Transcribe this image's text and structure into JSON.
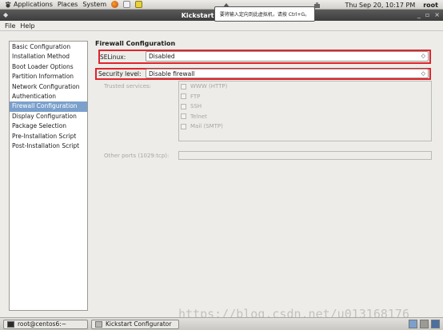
{
  "top_panel": {
    "menus": [
      "Applications",
      "Places",
      "System"
    ],
    "datetime": "Thu Sep 20, 10:17 PM",
    "user": "root"
  },
  "tooltip": {
    "text": "要将输入定向到此虚拟机，请按 Ctrl+G。"
  },
  "window": {
    "title": "Kickstart Configurator"
  },
  "menubar": {
    "items": [
      "File",
      "Help"
    ]
  },
  "nav": {
    "items": [
      "Basic Configuration",
      "Installation Method",
      "Boot Loader Options",
      "Partition Information",
      "Network Configuration",
      "Authentication",
      "Firewall Configuration",
      "Display Configuration",
      "Package Selection",
      "Pre-Installation Script",
      "Post-Installation Script"
    ],
    "selected_index": 6
  },
  "firewall": {
    "title": "Firewall Configuration",
    "selinux_label": "SELinux:",
    "selinux_value": "Disabled",
    "security_label": "Security level:",
    "security_value": "Disable firewall",
    "trusted_label": "Trusted services:",
    "services": [
      "WWW (HTTP)",
      "FTP",
      "SSH",
      "Telnet",
      "Mail (SMTP)"
    ],
    "ports_label": "Other ports (1029:tcp):",
    "ports_value": ""
  },
  "taskbar": {
    "tasks": [
      "root@centos6:~",
      "Kickstart Configurator"
    ]
  },
  "watermark": "https://blog.csdn.net/u013168176",
  "colors": {
    "highlight": "#e0242b",
    "selected": "#7ba0cc"
  }
}
